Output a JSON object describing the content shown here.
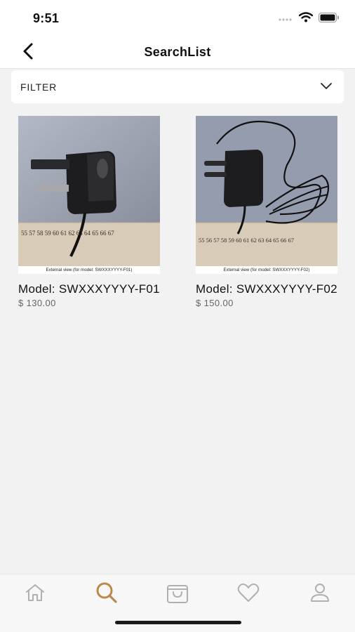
{
  "status_bar": {
    "time": "9:51"
  },
  "nav": {
    "title": "SearchList",
    "back_icon": "chevron-left-icon"
  },
  "filter": {
    "label": "FILTER",
    "icon": "chevron-down-icon"
  },
  "products": [
    {
      "name": "Model: SWXXXYYYY-F01",
      "price": "$ 130.00",
      "caption": "External view (for model: SWXXXYYYY-F01)",
      "ruler": "55 57 58 59 60 61 62 63 64 65 66 67"
    },
    {
      "name": "Model: SWXXXYYYY-F02",
      "price": "$ 150.00",
      "caption": "External view (for model: SWXXXYYYY-F02)",
      "ruler": "55 56 57 58 59 60 61 62 63 64 65 66 67"
    }
  ],
  "tab_bar": {
    "tabs": [
      {
        "icon": "home-icon"
      },
      {
        "icon": "search-icon",
        "active": true
      },
      {
        "icon": "shopping-bag-icon"
      },
      {
        "icon": "heart-icon"
      },
      {
        "icon": "profile-icon"
      }
    ],
    "active_color": "#b98a4b",
    "inactive_color": "#b0b0b0"
  }
}
